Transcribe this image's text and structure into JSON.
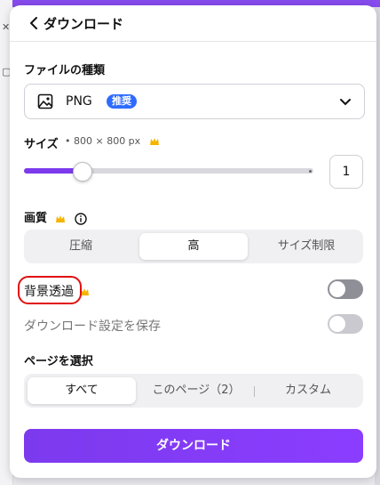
{
  "header": {
    "title": "ダウンロード"
  },
  "file_type": {
    "label": "ファイルの種類",
    "value": "PNG",
    "badge": "推奨"
  },
  "size": {
    "label": "サイズ",
    "dimensions": "• 800 × 800 px",
    "scale_value": "1",
    "slider_fraction": 0.2
  },
  "quality": {
    "label": "画質",
    "options": [
      "圧縮",
      "高",
      "サイズ制限"
    ],
    "selected": "高"
  },
  "transparent_bg": {
    "label": "背景透過",
    "on": false
  },
  "save_settings": {
    "label": "ダウンロード設定を保存",
    "on": false
  },
  "pages": {
    "label": "ページを選択",
    "options": [
      "すべて",
      "このページ（2）",
      "カスタム"
    ],
    "selected": "すべて"
  },
  "download_button": {
    "label": "ダウンロード"
  },
  "colors": {
    "accent": "#7c3aed",
    "badge": "#2f6bff",
    "crown": "#f4b400",
    "highlight": "#e01010"
  },
  "icons": [
    "chevron-left-icon",
    "image-icon",
    "chevron-down-icon",
    "crown-icon",
    "info-icon"
  ]
}
